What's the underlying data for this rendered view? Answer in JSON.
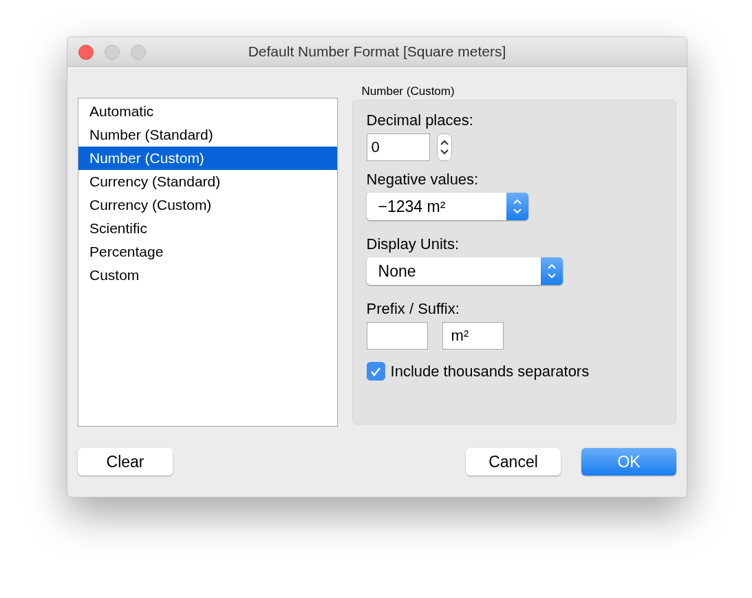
{
  "window": {
    "title": "Default Number Format [Square meters]"
  },
  "format_list": {
    "items": [
      {
        "label": "Automatic",
        "selected": false
      },
      {
        "label": "Number (Standard)",
        "selected": false
      },
      {
        "label": "Number (Custom)",
        "selected": true
      },
      {
        "label": "Currency (Standard)",
        "selected": false
      },
      {
        "label": "Currency (Custom)",
        "selected": false
      },
      {
        "label": "Scientific",
        "selected": false
      },
      {
        "label": "Percentage",
        "selected": false
      },
      {
        "label": "Custom",
        "selected": false
      }
    ]
  },
  "panel": {
    "title": "Number (Custom)",
    "decimal_places": {
      "label": "Decimal places:",
      "value": "0"
    },
    "negative_values": {
      "label": "Negative values:",
      "value": "−1234 m²"
    },
    "display_units": {
      "label": "Display Units:",
      "value": "None"
    },
    "prefix_suffix": {
      "label": "Prefix / Suffix:",
      "suffix": "m²"
    },
    "thousands_separators": {
      "label": "Include thousands separators",
      "checked": true
    }
  },
  "footer": {
    "left": [
      {
        "label": "Clear",
        "kind": "plain"
      }
    ],
    "right": [
      {
        "label": "Cancel",
        "kind": "plain"
      },
      {
        "label": "OK",
        "kind": "default"
      }
    ]
  }
}
